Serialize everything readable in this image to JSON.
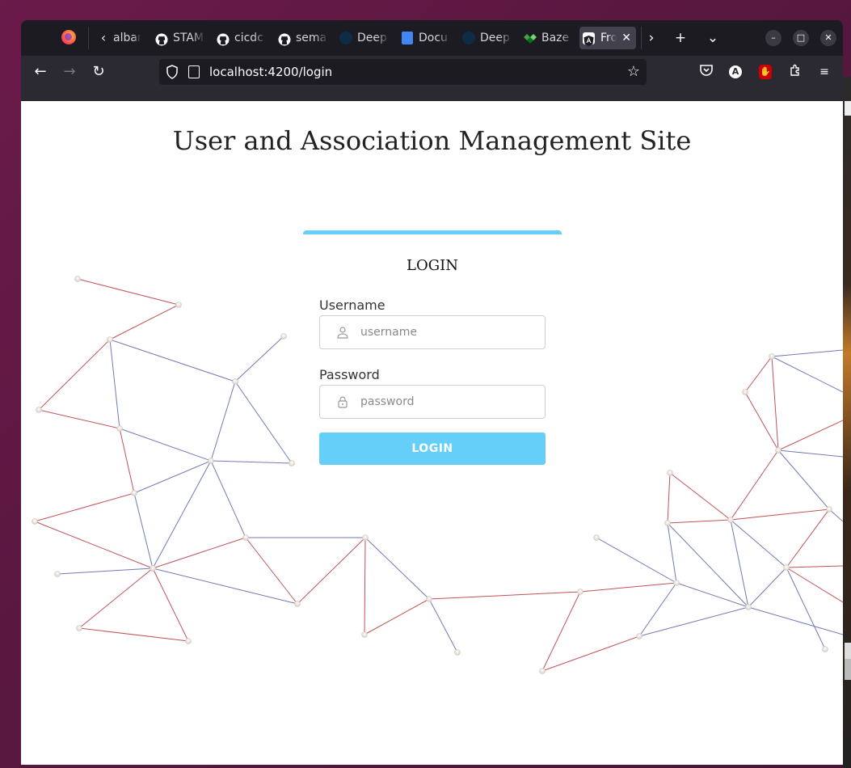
{
  "browser": {
    "tabs": [
      {
        "label": "albar",
        "icon": "page-icon"
      },
      {
        "label": "STAMP",
        "icon": "github-icon"
      },
      {
        "label": "cicdc",
        "icon": "github-icon"
      },
      {
        "label": "sema",
        "icon": "github-icon"
      },
      {
        "label": "Deep",
        "icon": "deepl-icon"
      },
      {
        "label": "Docu",
        "icon": "docs-icon"
      },
      {
        "label": "Deep",
        "icon": "deepl-icon"
      },
      {
        "label": "Baze",
        "icon": "bazel-icon"
      },
      {
        "label": "Fro",
        "icon": "angular-icon",
        "active": true
      }
    ],
    "url_host": "localhost",
    "url_rest": ":4200/login",
    "close_glyph": "✕",
    "new_tab_glyph": "+",
    "list_tabs_glyph": "⌄"
  },
  "page": {
    "title": "User and Association Management Site",
    "login": {
      "heading": "LOGIN",
      "username_label": "Username",
      "username_placeholder": "username",
      "password_label": "Password",
      "password_placeholder": "password",
      "button_label": "LOGIN"
    }
  },
  "colors": {
    "accent": "#66cff9",
    "chrome_dark": "#1c1b22",
    "chrome_toolbar": "#2b2a33"
  }
}
